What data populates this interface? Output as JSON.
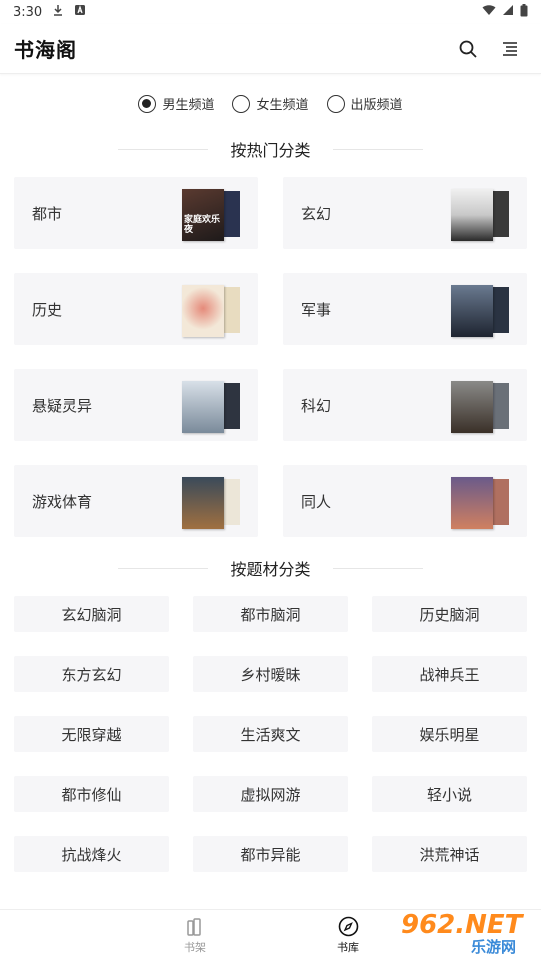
{
  "status_bar": {
    "time": "3:30"
  },
  "header": {
    "title": "书海阁"
  },
  "channels": [
    {
      "label": "男生频道",
      "selected": true
    },
    {
      "label": "女生频道",
      "selected": false
    },
    {
      "label": "出版频道",
      "selected": false
    }
  ],
  "hot_section": {
    "title": "按热门分类"
  },
  "hot_categories": [
    {
      "label": "都市",
      "cover_text": "家庭欢乐夜",
      "cover_color": "#3a2a2a",
      "back_color": "#2a3350"
    },
    {
      "label": "玄幻",
      "cover_text": "",
      "cover_color": "#dfe0e0",
      "back_color": "#3a3a3a"
    },
    {
      "label": "历史",
      "cover_text": "",
      "cover_color": "#f0e7d8",
      "back_color": "#e8dcc0"
    },
    {
      "label": "军事",
      "cover_text": "",
      "cover_color": "#3a4658",
      "back_color": "#2a3342"
    },
    {
      "label": "悬疑灵异",
      "cover_text": "",
      "cover_color": "#aab6c2",
      "back_color": "#2e3440"
    },
    {
      "label": "科幻",
      "cover_text": "",
      "cover_color": "#5a5048",
      "back_color": "#6a7078"
    },
    {
      "label": "游戏体育",
      "cover_text": "",
      "cover_color": "#4a6070",
      "back_color": "#ece6d8"
    },
    {
      "label": "同人",
      "cover_text": "",
      "cover_color": "#7a6a8a",
      "back_color": "#b07060"
    }
  ],
  "topic_section": {
    "title": "按题材分类"
  },
  "topics": [
    "玄幻脑洞",
    "都市脑洞",
    "历史脑洞",
    "东方玄幻",
    "乡村暧昧",
    "战神兵王",
    "无限穿越",
    "生活爽文",
    "娱乐明星",
    "都市修仙",
    "虚拟网游",
    "轻小说",
    "抗战烽火",
    "都市异能",
    "洪荒神话"
  ],
  "bottom_nav": [
    {
      "label": "书架",
      "icon": "bookshelf-icon",
      "active": false
    },
    {
      "label": "书库",
      "icon": "compass-icon",
      "active": true
    }
  ],
  "watermark": {
    "number": "962.NET",
    "subtitle": "乐游网"
  }
}
